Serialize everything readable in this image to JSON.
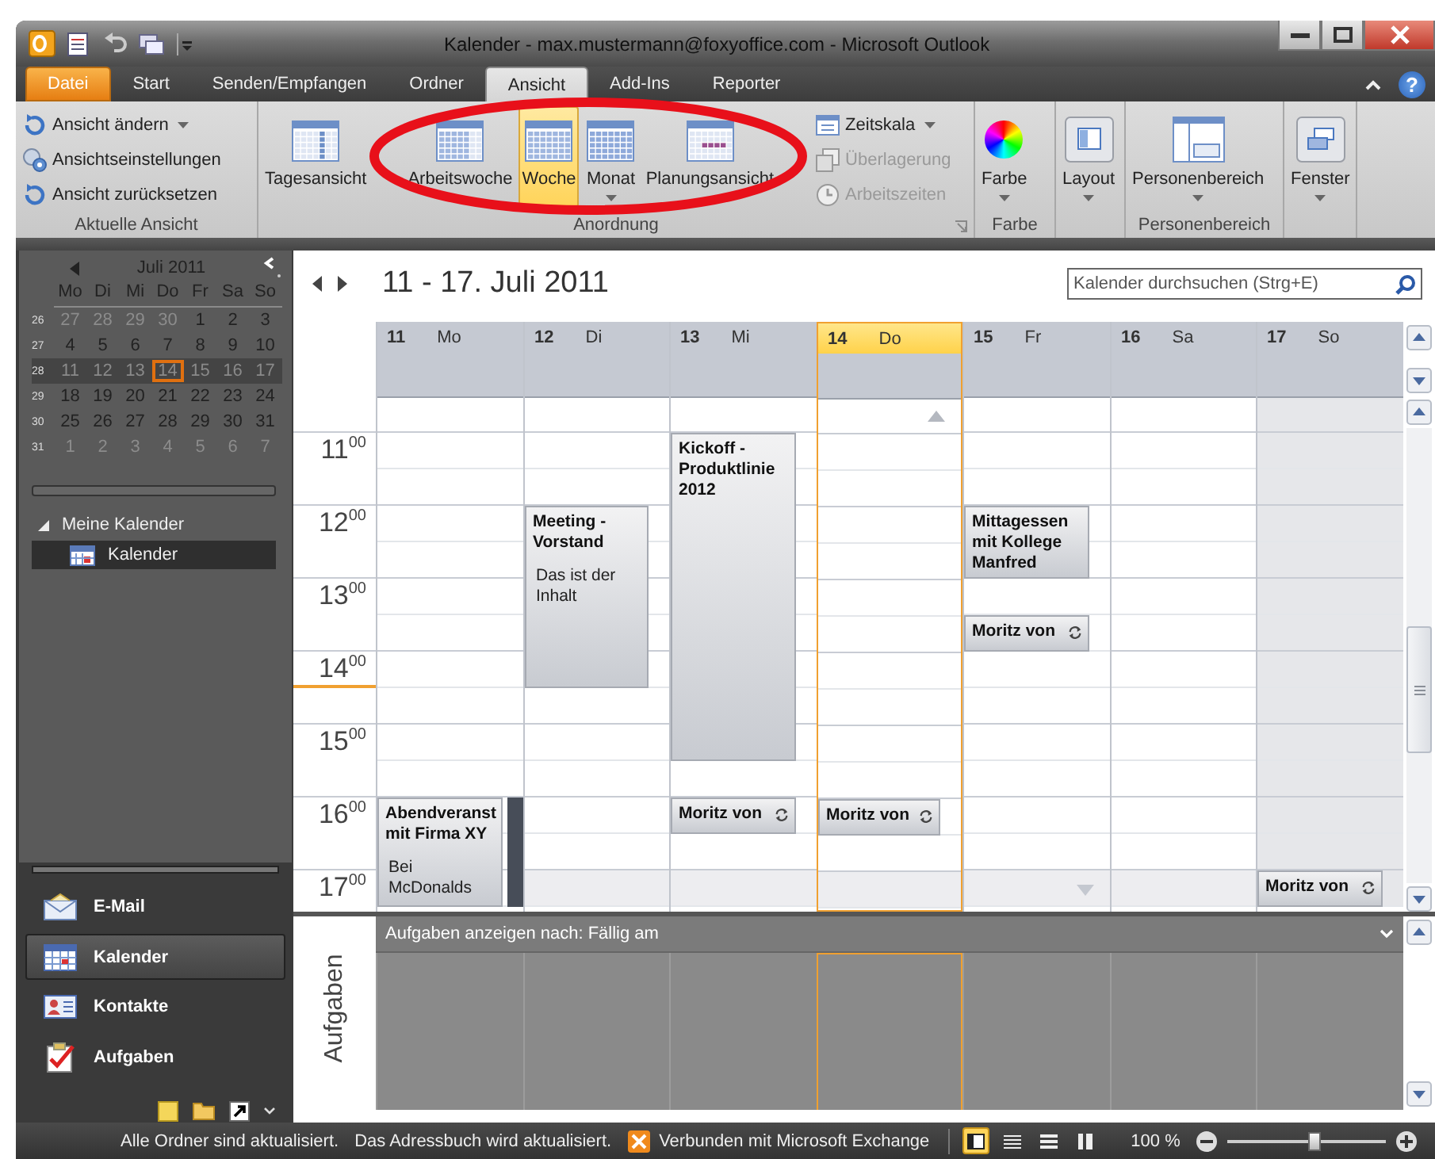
{
  "window": {
    "title": "Kalender - max.mustermann@foxyoffice.com - Microsoft Outlook"
  },
  "ribbon_tabs": [
    {
      "label": "Datei",
      "kind": "backstage",
      "selected": false
    },
    {
      "label": "Start",
      "kind": "tab",
      "selected": false
    },
    {
      "label": "Senden/Empfangen",
      "kind": "tab",
      "selected": false
    },
    {
      "label": "Ordner",
      "kind": "tab",
      "selected": false
    },
    {
      "label": "Ansicht",
      "kind": "tab",
      "selected": true
    },
    {
      "label": "Add-Ins",
      "kind": "tab",
      "selected": false
    },
    {
      "label": "Reporter",
      "kind": "tab",
      "selected": false
    }
  ],
  "help_label": "?",
  "ribbon_groups": [
    {
      "label": "Aktuelle Ansicht",
      "items": [
        {
          "kind": "small",
          "label": "Ansicht ändern",
          "dropdown": true,
          "selected": false,
          "disabled": false
        },
        {
          "kind": "small",
          "label": "Ansichtseinstellungen",
          "dropdown": false,
          "selected": false,
          "disabled": false
        },
        {
          "kind": "small",
          "label": "Ansicht zurücksetzen",
          "dropdown": false,
          "selected": false,
          "disabled": false
        }
      ]
    },
    {
      "label": "Anordnung",
      "dialog_launcher": true,
      "items": [
        {
          "kind": "large",
          "label": "Tagesansicht",
          "dropdown": false,
          "selected": false,
          "disabled": false
        },
        {
          "kind": "large",
          "label": "Arbeitswoche",
          "dropdown": false,
          "selected": false,
          "disabled": false
        },
        {
          "kind": "large",
          "label": "Woche",
          "dropdown": false,
          "selected": true,
          "disabled": false
        },
        {
          "kind": "large",
          "label": "Monat",
          "dropdown": true,
          "selected": false,
          "disabled": false
        },
        {
          "kind": "large",
          "label": "Planungsansicht",
          "dropdown": false,
          "selected": false,
          "disabled": false
        },
        {
          "kind": "small",
          "label": "Zeitskala",
          "dropdown": true,
          "selected": false,
          "disabled": false
        },
        {
          "kind": "small",
          "label": "Überlagerung",
          "dropdown": false,
          "selected": false,
          "disabled": true
        },
        {
          "kind": "small",
          "label": "Arbeitszeiten",
          "dropdown": false,
          "selected": false,
          "disabled": true
        }
      ]
    },
    {
      "label": "Farbe",
      "items": [
        {
          "kind": "large",
          "label": "Farbe",
          "dropdown": true,
          "selected": false,
          "disabled": false
        }
      ]
    },
    {
      "items": [
        {
          "kind": "large",
          "label": "Layout",
          "dropdown": true,
          "selected": false,
          "disabled": false
        }
      ]
    },
    {
      "label": "Personenbereich",
      "items": [
        {
          "kind": "large",
          "label": "Personenbereich",
          "dropdown": true,
          "selected": false,
          "disabled": false
        }
      ]
    },
    {
      "items": [
        {
          "kind": "large",
          "label": "Fenster",
          "dropdown": true,
          "selected": false,
          "disabled": false
        }
      ]
    }
  ],
  "mini_calendar": {
    "month": "Juli 2011",
    "weekdays": [
      "Mo",
      "Di",
      "Mi",
      "Do",
      "Fr",
      "Sa",
      "So"
    ],
    "weeks": [
      {
        "number": "26",
        "selected": false,
        "days": [
          {
            "label": "27",
            "other_month": true,
            "today": false
          },
          {
            "label": "28",
            "other_month": true,
            "today": false
          },
          {
            "label": "29",
            "other_month": true,
            "today": false
          },
          {
            "label": "30",
            "other_month": true,
            "today": false
          },
          {
            "label": "1",
            "other_month": false,
            "today": false
          },
          {
            "label": "2",
            "other_month": false,
            "today": false
          },
          {
            "label": "3",
            "other_month": false,
            "today": false
          }
        ]
      },
      {
        "number": "27",
        "selected": false,
        "days": [
          {
            "label": "4",
            "other_month": false,
            "today": false
          },
          {
            "label": "5",
            "other_month": false,
            "today": false
          },
          {
            "label": "6",
            "other_month": false,
            "today": false
          },
          {
            "label": "7",
            "other_month": false,
            "today": false
          },
          {
            "label": "8",
            "other_month": false,
            "today": false
          },
          {
            "label": "9",
            "other_month": false,
            "today": false
          },
          {
            "label": "10",
            "other_month": false,
            "today": false
          }
        ]
      },
      {
        "number": "28",
        "selected": true,
        "days": [
          {
            "label": "11",
            "other_month": false,
            "today": false
          },
          {
            "label": "12",
            "other_month": false,
            "today": false
          },
          {
            "label": "13",
            "other_month": false,
            "today": false
          },
          {
            "label": "14",
            "other_month": false,
            "today": true
          },
          {
            "label": "15",
            "other_month": false,
            "today": false
          },
          {
            "label": "16",
            "other_month": false,
            "today": false
          },
          {
            "label": "17",
            "other_month": false,
            "today": false
          }
        ]
      },
      {
        "number": "29",
        "selected": false,
        "days": [
          {
            "label": "18",
            "other_month": false,
            "today": false
          },
          {
            "label": "19",
            "other_month": false,
            "today": false
          },
          {
            "label": "20",
            "other_month": false,
            "today": false
          },
          {
            "label": "21",
            "other_month": false,
            "today": false
          },
          {
            "label": "22",
            "other_month": false,
            "today": false
          },
          {
            "label": "23",
            "other_month": false,
            "today": false
          },
          {
            "label": "24",
            "other_month": false,
            "today": false
          }
        ]
      },
      {
        "number": "30",
        "selected": false,
        "days": [
          {
            "label": "25",
            "other_month": false,
            "today": false
          },
          {
            "label": "26",
            "other_month": false,
            "today": false
          },
          {
            "label": "27",
            "other_month": false,
            "today": false
          },
          {
            "label": "28",
            "other_month": false,
            "today": false
          },
          {
            "label": "29",
            "other_month": false,
            "today": false
          },
          {
            "label": "30",
            "other_month": false,
            "today": false
          },
          {
            "label": "31",
            "other_month": false,
            "today": false
          }
        ]
      },
      {
        "number": "31",
        "selected": false,
        "days": [
          {
            "label": "1",
            "other_month": true,
            "today": false
          },
          {
            "label": "2",
            "other_month": true,
            "today": false
          },
          {
            "label": "3",
            "other_month": true,
            "today": false
          },
          {
            "label": "4",
            "other_month": true,
            "today": false
          },
          {
            "label": "5",
            "other_month": true,
            "today": false
          },
          {
            "label": "6",
            "other_month": true,
            "today": false
          },
          {
            "label": "7",
            "other_month": true,
            "today": false
          }
        ]
      }
    ]
  },
  "folders": {
    "label": "Meine Kalender",
    "expanded": true,
    "items": [
      {
        "label": "Kalender",
        "selected": true
      }
    ]
  },
  "nav_buttons": [
    {
      "label": "E-Mail",
      "selected": false
    },
    {
      "label": "Kalender",
      "selected": true
    },
    {
      "label": "Kontakte",
      "selected": false
    },
    {
      "label": "Aufgaben",
      "selected": false
    }
  ],
  "calendar": {
    "date_range": "11 - 17. Juli 2011",
    "search": {
      "placeholder": "Kalender durchsuchen (Strg+E)"
    },
    "hours": [
      {
        "label": "11$^{00}$",
        "current": false,
        "work_time": true
      },
      {
        "label": "12$^{00}$",
        "current": false,
        "work_time": true
      },
      {
        "label": "13$^{00}$",
        "current": false,
        "work_time": true
      },
      {
        "label": "14$^{00}$",
        "current": true,
        "work_time": true
      },
      {
        "label": "15$^{00}$",
        "current": false,
        "work_time": true
      },
      {
        "label": "16$^{00}$",
        "current": false,
        "work_time": true
      },
      {
        "label": "17$^{00}$",
        "current": false,
        "work_time": false
      }
    ],
    "days": [
      {
        "number": "11",
        "name": "Mo",
        "today": false,
        "shaded": false,
        "more_above": false,
        "more_below": false,
        "timeline": [
          {
            "kind": "free"
          },
          {
            "kind": "free"
          },
          {
            "kind": "free"
          },
          {
            "kind": "free"
          },
          {
            "kind": "free"
          },
          {
            "kind": "free"
          },
          {
            "kind": "free"
          },
          {
            "kind": "free"
          },
          {
            "kind": "free"
          },
          {
            "kind": "free"
          },
          {
            "kind": "event",
            "title": "Abendveranst\nmit Firma XY",
            "body": "Bei\nMcDonalds",
            "out_of_office": true,
            "recurring": false
          },
          {
            "kind": "continued"
          },
          {
            "kind": "continued"
          }
        ]
      },
      {
        "number": "12",
        "name": "Di",
        "today": false,
        "shaded": false,
        "more_above": false,
        "more_below": false,
        "timeline": [
          {
            "kind": "free"
          },
          {
            "kind": "free"
          },
          {
            "kind": "event",
            "title": "Meeting -\nVorstand",
            "body": "Das ist der\nInhalt",
            "out_of_office": false,
            "recurring": false
          },
          {
            "kind": "continued"
          },
          {
            "kind": "continued"
          },
          {
            "kind": "continued"
          },
          {
            "kind": "continued"
          },
          {
            "kind": "free"
          },
          {
            "kind": "free"
          },
          {
            "kind": "free"
          },
          {
            "kind": "free"
          },
          {
            "kind": "free"
          },
          {
            "kind": "free"
          }
        ]
      },
      {
        "number": "13",
        "name": "Mi",
        "today": false,
        "shaded": false,
        "more_above": false,
        "more_below": false,
        "timeline": [
          {
            "kind": "event",
            "title": "Kickoff -\nProduktlinie\n2012",
            "out_of_office": false,
            "recurring": false
          },
          {
            "kind": "continued"
          },
          {
            "kind": "continued"
          },
          {
            "kind": "continued"
          },
          {
            "kind": "continued"
          },
          {
            "kind": "continued"
          },
          {
            "kind": "continued"
          },
          {
            "kind": "continued"
          },
          {
            "kind": "continued"
          },
          {
            "kind": "free"
          },
          {
            "kind": "event",
            "title": "Moritz von",
            "out_of_office": false,
            "recurring": true
          },
          {
            "kind": "free"
          },
          {
            "kind": "free"
          }
        ]
      },
      {
        "number": "14",
        "name": "Do",
        "today": true,
        "shaded": false,
        "more_above": true,
        "more_below": false,
        "timeline": [
          {
            "kind": "free"
          },
          {
            "kind": "free"
          },
          {
            "kind": "free"
          },
          {
            "kind": "free"
          },
          {
            "kind": "free"
          },
          {
            "kind": "free"
          },
          {
            "kind": "free"
          },
          {
            "kind": "free"
          },
          {
            "kind": "free"
          },
          {
            "kind": "free"
          },
          {
            "kind": "event",
            "title": "Moritz von",
            "out_of_office": false,
            "recurring": true
          },
          {
            "kind": "free"
          },
          {
            "kind": "free"
          }
        ]
      },
      {
        "number": "15",
        "name": "Fr",
        "today": false,
        "shaded": false,
        "more_above": false,
        "more_below": true,
        "timeline": [
          {
            "kind": "free"
          },
          {
            "kind": "free"
          },
          {
            "kind": "event",
            "title": "Mittagessen\nmit Kollege\nManfred",
            "out_of_office": false,
            "recurring": false
          },
          {
            "kind": "continued"
          },
          {
            "kind": "free"
          },
          {
            "kind": "event",
            "title": "Moritz von",
            "out_of_office": false,
            "recurring": true
          },
          {
            "kind": "free"
          },
          {
            "kind": "free"
          },
          {
            "kind": "free"
          },
          {
            "kind": "free"
          },
          {
            "kind": "free"
          },
          {
            "kind": "free"
          },
          {
            "kind": "free"
          }
        ]
      },
      {
        "number": "16",
        "name": "Sa",
        "today": false,
        "shaded": false,
        "more_above": false,
        "more_below": false,
        "timeline": [
          {
            "kind": "free"
          },
          {
            "kind": "free"
          },
          {
            "kind": "free"
          },
          {
            "kind": "free"
          },
          {
            "kind": "free"
          },
          {
            "kind": "free"
          },
          {
            "kind": "free"
          },
          {
            "kind": "free"
          },
          {
            "kind": "free"
          },
          {
            "kind": "free"
          },
          {
            "kind": "free"
          },
          {
            "kind": "free"
          },
          {
            "kind": "free"
          }
        ]
      },
      {
        "number": "17",
        "name": "So",
        "today": false,
        "shaded": true,
        "more_above": false,
        "more_below": false,
        "timeline": [
          {
            "kind": "free"
          },
          {
            "kind": "free"
          },
          {
            "kind": "free"
          },
          {
            "kind": "free"
          },
          {
            "kind": "free"
          },
          {
            "kind": "free"
          },
          {
            "kind": "free"
          },
          {
            "kind": "free"
          },
          {
            "kind": "free"
          },
          {
            "kind": "free"
          },
          {
            "kind": "free"
          },
          {
            "kind": "free"
          },
          {
            "kind": "event",
            "title": "Moritz von",
            "out_of_office": false,
            "recurring": true
          }
        ]
      }
    ]
  },
  "tasks": {
    "label": "Aufgaben",
    "header": "Aufgaben anzeigen nach: Fällig am"
  },
  "status_bar": {
    "messages": [
      "Alle Ordner sind aktualisiert.",
      "Das Adressbuch wird aktualisiert."
    ],
    "connection": "Verbunden mit Microsoft Exchange",
    "views": [
      {
        "selected": true
      },
      {
        "selected": false
      },
      {
        "selected": false
      },
      {
        "selected": false
      }
    ],
    "zoom": "100 %",
    "zoom_slider": {
      "level": 0.55
    }
  }
}
